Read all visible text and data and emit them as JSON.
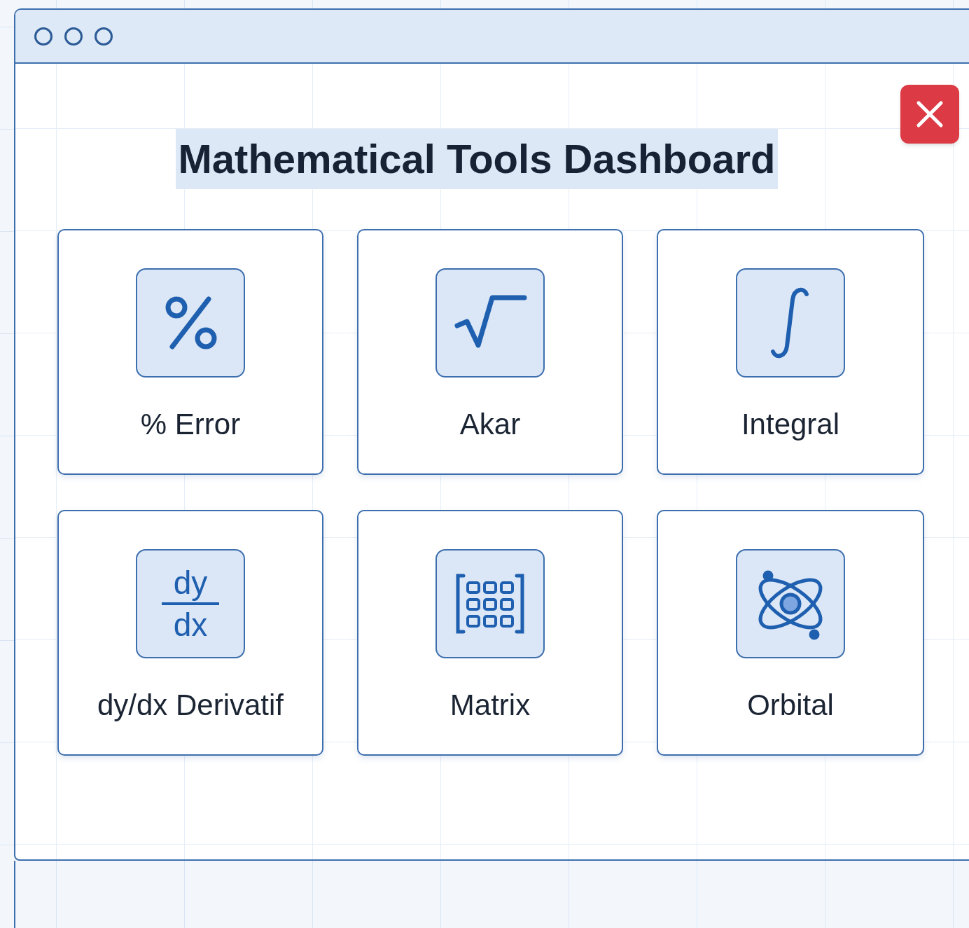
{
  "title": {
    "text": "Mathematical Tools Dashboard",
    "selected": true
  },
  "tools": [
    {
      "label": "% Error",
      "icon": {
        "kind": "percent"
      }
    },
    {
      "label": "Akar",
      "icon": {
        "kind": "root"
      }
    },
    {
      "label": "Integral",
      "icon": {
        "kind": "integral"
      }
    },
    {
      "label": "dy/dx Derivatif",
      "icon": {
        "kind": "fraction",
        "numerator": "dy",
        "denominator": "dx"
      }
    },
    {
      "label": "Matrix",
      "icon": {
        "kind": "matrix"
      }
    },
    {
      "label": "Orbital",
      "icon": {
        "kind": "atom"
      }
    }
  ]
}
